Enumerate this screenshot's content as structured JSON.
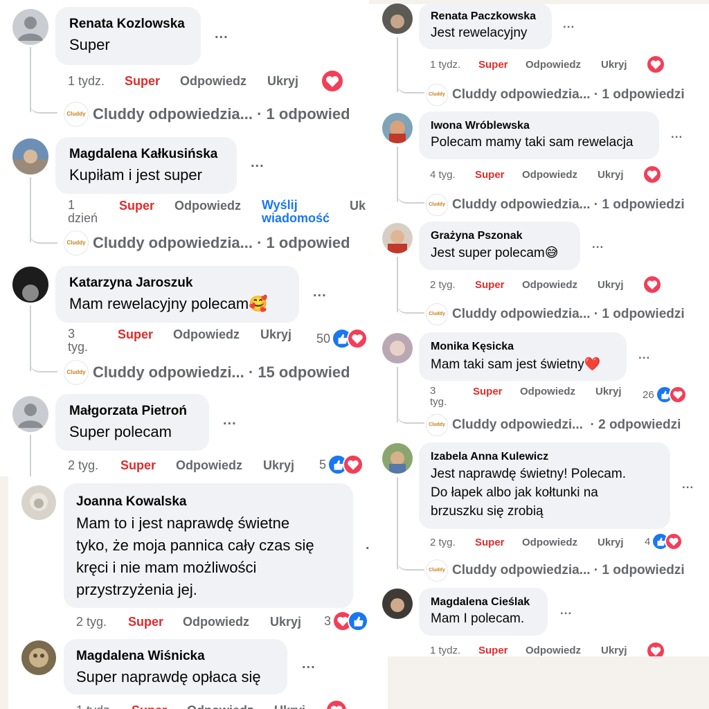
{
  "actions": {
    "reply": "Odpowiedz",
    "hide": "Ukryj",
    "reaction": "Super",
    "send_message": "Wyślij wiadomość",
    "more": "..."
  },
  "icons": {
    "like": "like-icon",
    "love": "heart-icon",
    "more": "more-icon"
  },
  "colors": {
    "love": "#f33e58",
    "like": "#1877f2",
    "super": "#e02b2b",
    "link": "#1877f2",
    "bubble": "#f0f2f5"
  },
  "brand": {
    "logo_text": "Cluddy"
  },
  "left_comments": [
    {
      "name": "Renata Kozlowska",
      "text": "Super",
      "time": "1 tydz.",
      "reply": "Cluddy odpowiedzia... · 1 odpowied"
    },
    {
      "name": "Magdalena Kałkusińska",
      "text": "Kupiłam i jest super",
      "time": "1 dzień",
      "time_line1": "1",
      "time_line2": "dzień",
      "hide_partial": "Uk",
      "reply": "Cluddy odpowiedzia... · 1 odpowied"
    },
    {
      "name": "Katarzyna Jaroszuk",
      "text": "Mam rewelacyjny polecam🥰",
      "time": "3 tyg.",
      "time_line1": "3",
      "time_line2": "tyg.",
      "count": "50",
      "reply": "Cluddy odpowiedzi... · 15 odpowied"
    },
    {
      "name": "Małgorzata Pietroń",
      "text": "Super polecam",
      "time": "2 tyg.",
      "count": "5"
    },
    {
      "name": "Joanna Kowalska",
      "lines": [
        "Mam to i jest naprawdę świetne",
        "tyko, że moja pannica cały czas się",
        "kręci i nie mam możliwości",
        "przystrzyżenia jej."
      ],
      "time": "2 tyg.",
      "count": "3"
    },
    {
      "name": "Magdalena Wiśnicka",
      "text": "Super naprawdę opłaca się",
      "time": "1 tydz."
    }
  ],
  "right_comments": [
    {
      "name": "Renata Paczkowska",
      "text": "Jest rewelacyjny",
      "time": "1 tydz.",
      "reply": "Cluddy odpowiedzia... · 1 odpowiedzi"
    },
    {
      "name": "Iwona Wróblewska",
      "text": "Polecam mamy taki sam rewelacja",
      "time": "4 tyg.",
      "reply": "Cluddy odpowiedzia... · 1 odpowiedzi"
    },
    {
      "name": "Grażyna Pszonak",
      "text": "Jest super polecam😅",
      "time": "2 tyg.",
      "reply": "Cluddy odpowiedzia... · 1 odpowiedzi"
    },
    {
      "name": "Monika Kęsicka",
      "text": "Mam taki sam jest świetny❤️",
      "time": "3 tyg.",
      "time_line1": "3",
      "time_line2": "tyg.",
      "count": "26",
      "reply": "Cluddy odpowiedzi...  · 2 odpowiedzi"
    },
    {
      "name": "Izabela Anna Kulewicz",
      "lines": [
        "Jest naprawdę świetny! Polecam.",
        "Do łapek albo jak kołtunki na",
        "brzuszku się zrobią"
      ],
      "time": "2 tyg.",
      "count": "4",
      "reply": "Cluddy odpowiedzia... · 1 odpowiedzi"
    },
    {
      "name": "Magdalena Cieślak",
      "text": "Mam I polecam.",
      "time": "1 tydz."
    }
  ]
}
